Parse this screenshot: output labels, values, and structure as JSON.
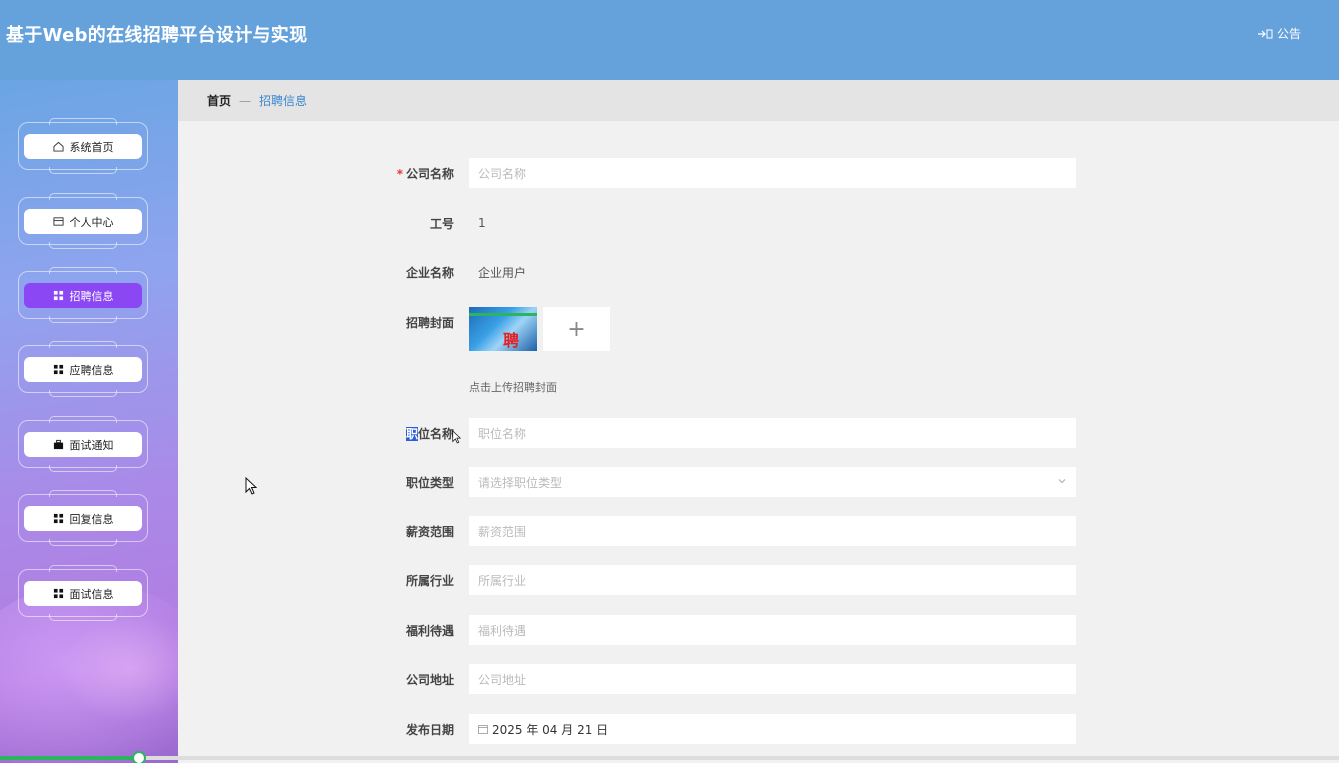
{
  "header": {
    "title": "基于Web的在线招聘平台设计与实现",
    "notice_label": "公告"
  },
  "sidebar": {
    "items": [
      {
        "label": "系统首页",
        "icon": "home-icon",
        "active": false
      },
      {
        "label": "个人中心",
        "icon": "wallet-icon",
        "active": false
      },
      {
        "label": "招聘信息",
        "icon": "grid-icon",
        "active": true
      },
      {
        "label": "应聘信息",
        "icon": "grid-icon",
        "active": false
      },
      {
        "label": "面试通知",
        "icon": "briefcase-icon",
        "active": false
      },
      {
        "label": "回复信息",
        "icon": "grid-icon",
        "active": false
      },
      {
        "label": "面试信息",
        "icon": "grid-icon",
        "active": false
      }
    ]
  },
  "breadcrumb": {
    "home": "首页",
    "separator": "—",
    "current": "招聘信息"
  },
  "form": {
    "company_name": {
      "label": "公司名称",
      "placeholder": "公司名称",
      "required_mark": "*"
    },
    "employee_id": {
      "label": "工号",
      "value": "1"
    },
    "enterprise_name": {
      "label": "企业名称",
      "value": "企业用户"
    },
    "cover": {
      "label": "招聘封面",
      "image_text": "聘",
      "upload_symbol": "+",
      "hint": "点击上传招聘封面"
    },
    "position_name": {
      "label_part1": "职",
      "label_part2": "位名称",
      "placeholder": "职位名称"
    },
    "position_type": {
      "label": "职位类型",
      "placeholder": "请选择职位类型"
    },
    "salary_range": {
      "label": "薪资范围",
      "placeholder": "薪资范围"
    },
    "industry": {
      "label": "所属行业",
      "placeholder": "所属行业"
    },
    "benefits": {
      "label": "福利待遇",
      "placeholder": "福利待遇"
    },
    "company_address": {
      "label": "公司地址",
      "placeholder": "公司地址"
    },
    "publish_date": {
      "label": "发布日期",
      "value": "2025 年 04 月 21 日"
    }
  },
  "colors": {
    "header_bg": "#65a2dc",
    "active_menu": "#8a47f3",
    "link": "#3a86d0",
    "required": "#e33333"
  }
}
